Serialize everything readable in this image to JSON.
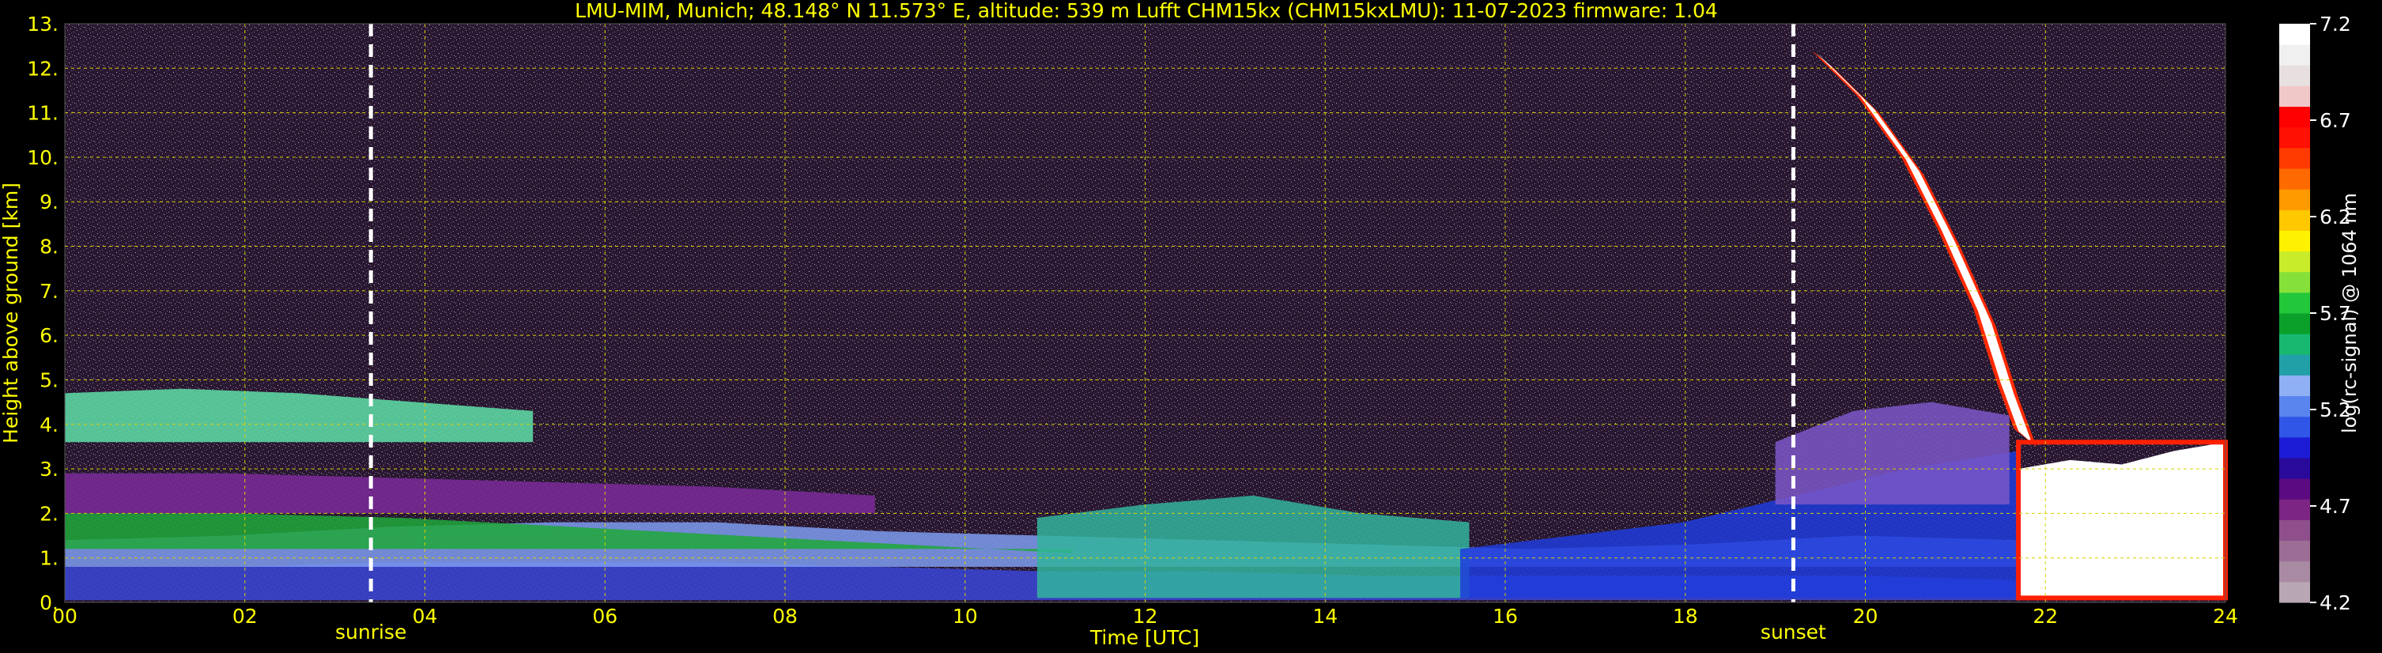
{
  "chart_data": {
    "type": "heatmap",
    "title": "LMU-MIM, Munich; 48.148° N 11.573° E, altitude: 539 m    Lufft CHM15kx (CHM15kxLMU): 11-07-2023    firmware: 1.04",
    "xlabel": "Time [UTC]",
    "ylabel": "Height above ground [km]",
    "xlim": [
      0,
      24
    ],
    "ylim": [
      0,
      13
    ],
    "x_ticks": [
      "00",
      "02",
      "04",
      "06",
      "08",
      "10",
      "12",
      "14",
      "16",
      "18",
      "20",
      "22",
      "24"
    ],
    "y_ticks": [
      "0.",
      "1.",
      "2.",
      "3.",
      "4.",
      "5.",
      "6.",
      "7.",
      "8.",
      "9.",
      "10.",
      "11.",
      "12.",
      "13."
    ],
    "grid": true,
    "annotations": [
      {
        "label": "sunrise",
        "time": 3.4
      },
      {
        "label": "sunset",
        "time": 19.2
      }
    ],
    "colorbar": {
      "label": "log(rc-signal) @ 1064 nm",
      "range": [
        4.2,
        7.2
      ],
      "ticks": [
        "4.2",
        "4.7",
        "5.2",
        "5.7",
        "6.2",
        "6.7",
        "7.2"
      ],
      "colors": [
        "#b9a6b4",
        "#a98aa3",
        "#9c6e96",
        "#8e4f8c",
        "#7d2585",
        "#5b0a82",
        "#2a0a9a",
        "#1c1cd6",
        "#2f56e6",
        "#5a84ee",
        "#8fb0f4",
        "#22a0a8",
        "#18b870",
        "#0aa02a",
        "#22c83a",
        "#86e03a",
        "#c8ec2a",
        "#fff200",
        "#ffc800",
        "#ff9a00",
        "#ff6a00",
        "#ff3a00",
        "#ff1000",
        "#ff0000",
        "#f0c8c8",
        "#e8e0e0",
        "#f0f0f0",
        "#ffffff"
      ]
    },
    "layers": [
      {
        "name": "aerosol-core",
        "t0": 0,
        "t1": 21.7,
        "h0": 0.05,
        "h1": [
          0.8,
          0.8,
          0.9,
          0.9,
          0.9,
          0.8,
          0.7,
          0.7,
          0.6,
          0.6,
          0.6,
          0.6,
          0.5
        ],
        "color": "#3a46d8"
      },
      {
        "name": "aerosol-mid",
        "t0": 0,
        "t1": 21.7,
        "h0": 0.8,
        "h1": [
          1.4,
          1.5,
          1.7,
          1.8,
          1.8,
          1.6,
          1.5,
          1.4,
          1.3,
          1.2,
          1.3,
          1.5,
          1.4
        ],
        "color": "#7e9cf0"
      },
      {
        "name": "mixing-green",
        "t0": 0,
        "t1": 11.2,
        "h0": 1.2,
        "h1": [
          2.0,
          2.0,
          1.9,
          1.7,
          1.5,
          1.3,
          1.1
        ],
        "color": "#1fa83a"
      },
      {
        "name": "residual-purple",
        "t0": 0,
        "t1": 9.0,
        "h0": 2.0,
        "h1": [
          2.9,
          2.9,
          2.8,
          2.7,
          2.6,
          2.4
        ],
        "color": "#7b2a9a"
      },
      {
        "name": "lofted-cyan",
        "t0": 0,
        "t1": 5.2,
        "h0": 3.6,
        "h1": [
          4.7,
          4.8,
          4.7,
          4.5,
          4.3
        ],
        "color": "#5fe0a8"
      },
      {
        "name": "convective-cells",
        "t0": 10.8,
        "t1": 15.6,
        "h0": 0.1,
        "h1": [
          1.9,
          2.2,
          2.4,
          2.0,
          1.8
        ],
        "color": "#32b49c"
      },
      {
        "name": "evening-blue",
        "t0": 15.5,
        "t1": 21.7,
        "h0": 0.1,
        "h1": [
          1.2,
          1.5,
          1.8,
          2.4,
          3.0,
          3.4
        ],
        "color": "#1e3cdc"
      },
      {
        "name": "evening-aerosol",
        "t0": 19.0,
        "t1": 21.6,
        "h0": 2.2,
        "h1": [
          3.6,
          4.3,
          4.5,
          4.2
        ],
        "color": "#7b57c8"
      },
      {
        "name": "cirrus-band",
        "t0": 19.4,
        "t1": 21.7,
        "h0": 0,
        "h1": [
          0
        ],
        "color": "#ffffff"
      },
      {
        "name": "low-cloud",
        "t0": 21.7,
        "t1": 24.0,
        "h0": 0.1,
        "h1": [
          3.0,
          3.2,
          3.1,
          3.4,
          3.6
        ],
        "color": "#ffffff"
      }
    ]
  }
}
